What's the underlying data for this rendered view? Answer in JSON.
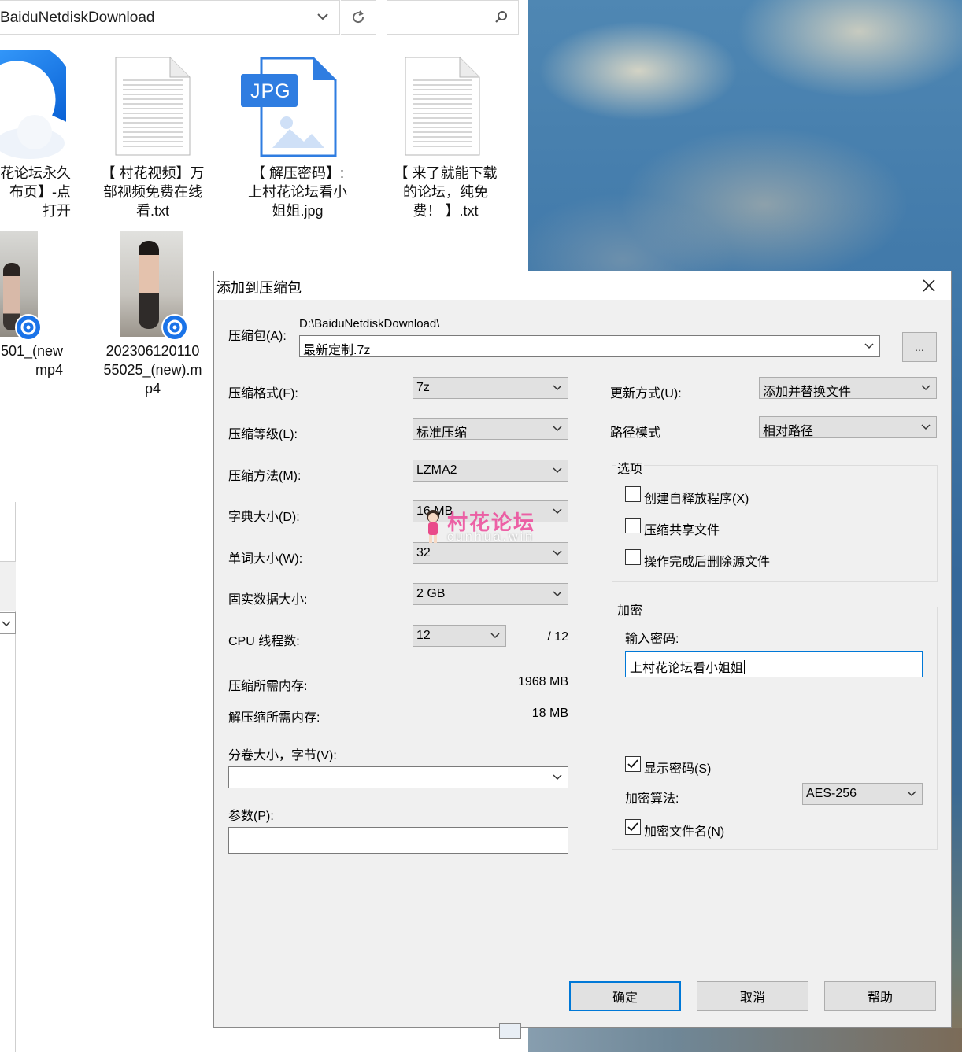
{
  "explorer": {
    "address": "BaiduNetdiskDownload",
    "files": [
      {
        "name": "花论坛永久\n布页】-点\n打开",
        "type": "browser-shortcut"
      },
      {
        "name": "【 村花视频】万\n部视频免费在线\n看.txt",
        "type": "text"
      },
      {
        "name": "【 解压密码】:\n上村花论坛看小\n姐姐.jpg",
        "type": "jpg",
        "badge": "JPG"
      },
      {
        "name": "【 来了就能下载\n的论坛，纯免\n费！ 】.txt",
        "type": "text"
      },
      {
        "name": "501_(new\nmp4",
        "type": "video"
      },
      {
        "name": "202306120110\n55025_(new).m\np4",
        "type": "video"
      }
    ]
  },
  "dialog": {
    "title": "添加到压缩包",
    "archive_label": "压缩包(A):",
    "archive_path": "D:\\BaiduNetdiskDownload\\",
    "archive_name": "最新定制.7z",
    "browse_label": "...",
    "format_label": "压缩格式(F):",
    "format_value": "7z",
    "level_label": "压缩等级(L):",
    "level_value": "标准压缩",
    "method_label": "压缩方法(M):",
    "method_value": "LZMA2",
    "dict_label": "字典大小(D):",
    "dict_value": "16 MB",
    "word_label": "单词大小(W):",
    "word_value": "32",
    "solid_label": "固实数据大小:",
    "solid_value": "2 GB",
    "cpu_label": "CPU 线程数:",
    "cpu_value": "12",
    "cpu_total": "/ 12",
    "mem_compress_label": "压缩所需内存:",
    "mem_compress_value": "1968 MB",
    "mem_decompress_label": "解压缩所需内存:",
    "mem_decompress_value": "18 MB",
    "volume_label": "分卷大小，字节(V):",
    "volume_value": "",
    "params_label": "参数(P):",
    "params_value": "",
    "update_label": "更新方式(U):",
    "update_value": "添加并替换文件",
    "path_label": "路径模式",
    "path_value": "相对路径",
    "options_title": "选项",
    "options": [
      {
        "label": "创建自释放程序(X)",
        "checked": false
      },
      {
        "label": "压缩共享文件",
        "checked": false
      },
      {
        "label": "操作完成后删除源文件",
        "checked": false
      }
    ],
    "encrypt_title": "加密",
    "password_label": "输入密码:",
    "password_value": "上村花论坛看小姐姐",
    "show_password_label": "显示密码(S)",
    "show_password_checked": true,
    "enc_method_label": "加密算法:",
    "enc_method_value": "AES-256",
    "encrypt_names_label": "加密文件名(N)",
    "encrypt_names_checked": true,
    "ok_label": "确定",
    "cancel_label": "取消",
    "help_label": "帮助"
  },
  "watermark": {
    "text": "村花论坛",
    "sub": "cunhua.win"
  },
  "colors": {
    "accent": "#0078d7",
    "dialog_bg": "#f0f0f0",
    "watermark": "#ec4899"
  }
}
